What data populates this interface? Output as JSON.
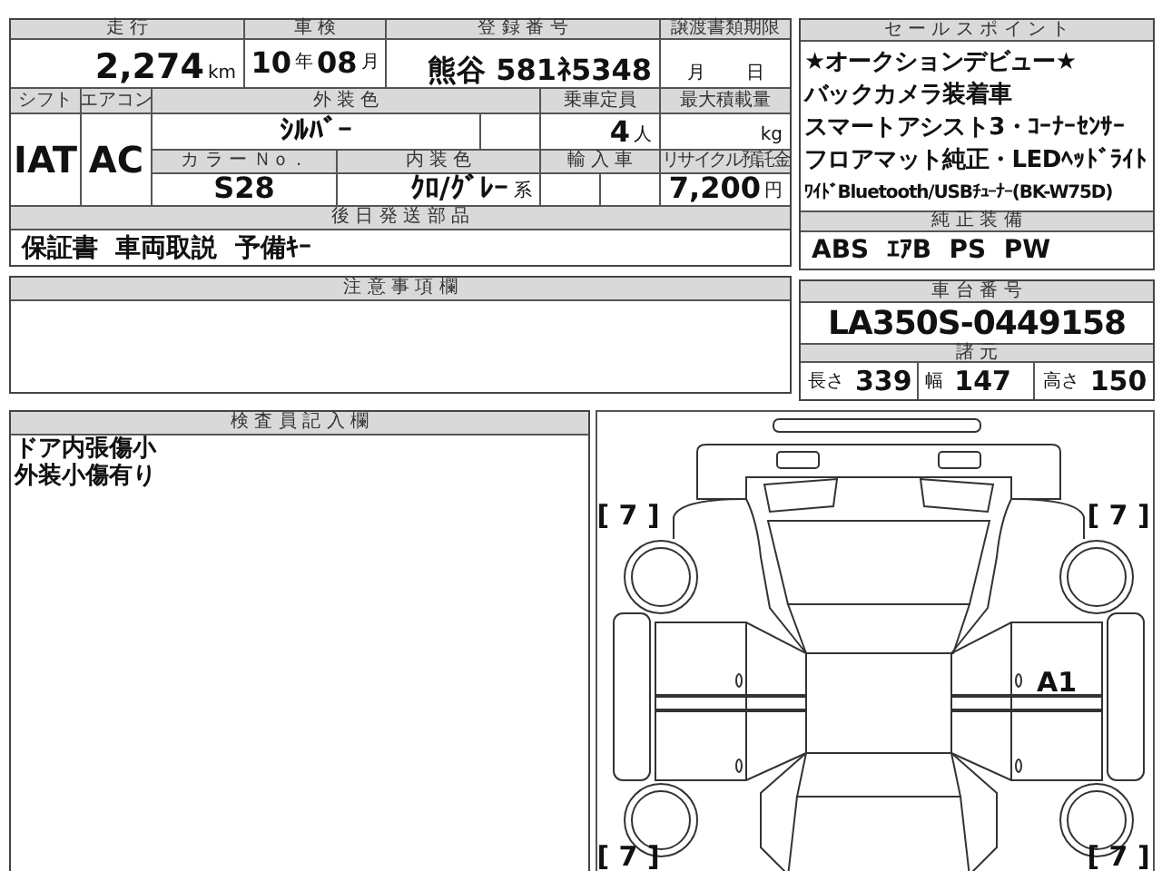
{
  "sheet": {
    "mileage": {
      "label": "走 行",
      "value": "2,274",
      "unit": "km"
    },
    "inspection": {
      "label": "車 検",
      "year": "10",
      "year_unit": "年",
      "month": "08",
      "month_unit": "月"
    },
    "registration": {
      "label": "登 録 番 号",
      "value": "熊谷 581ﾈ5348"
    },
    "transfer_deadline": {
      "label": "譲渡書類期限",
      "month_unit": "月",
      "day_unit": "日"
    },
    "shift": {
      "label": "シフト",
      "value": "IAT"
    },
    "aircon": {
      "label": "エアコン",
      "value": "AC"
    },
    "exterior_color": {
      "label": "外 装 色",
      "value": "ｼﾙﾊﾞｰ"
    },
    "capacity": {
      "label": "乗車定員",
      "value": "4",
      "unit": "人"
    },
    "max_load": {
      "label": "最大積載量",
      "unit": "kg"
    },
    "color_no": {
      "label": "カ ラ ー Ｎｏ．",
      "value": "S28"
    },
    "interior_color": {
      "label": "内 装 色",
      "value": "ｸﾛ/ｸﾞﾚｰ",
      "suffix": "系"
    },
    "import": {
      "label": "輸 入 車"
    },
    "recycle": {
      "label": "リサイクル預託金",
      "value": "7,200",
      "unit": "円"
    },
    "later_parts": {
      "label": "後 日 発 送 部 品",
      "value": "保証書  車両取説  予備ｷｰ"
    },
    "notes": {
      "label": "注 意 事 項 欄"
    },
    "inspector": {
      "label": "検 査 員 記 入 欄",
      "lines": [
        "ドア内張傷小",
        "外装小傷有り"
      ]
    }
  },
  "side": {
    "sales_points": {
      "label": "セ ー ル ス ポ イ ン ト",
      "items": [
        "★オークションデビュー★",
        "バックカメラ装着車",
        "スマートアシスト3・ｺｰﾅｰｾﾝｻｰ",
        "フロアマット純正・LEDﾍｯﾄﾞﾗｲﾄ",
        "ﾜｲﾄﾞBluetooth/USBﾁｭｰﾅｰ(BK-W75D)"
      ]
    },
    "equipment": {
      "label": "純 正 装 備",
      "value": "ABS  ｴｱB  PS  PW"
    },
    "chassis": {
      "label": "車 台 番 号",
      "value": "LA350S-0449158"
    },
    "specs": {
      "label": "諸 元",
      "items": [
        {
          "label": "長さ",
          "value": "339"
        },
        {
          "label": "幅",
          "value": "147"
        },
        {
          "label": "高さ",
          "value": "150"
        }
      ]
    }
  },
  "diagram": {
    "marks": [
      {
        "text": "[ 7 ]"
      },
      {
        "text": "[ 7 ]"
      },
      {
        "text": "[ 7 ]"
      },
      {
        "text": "[ 7 ]"
      },
      {
        "text": "A1"
      }
    ]
  }
}
